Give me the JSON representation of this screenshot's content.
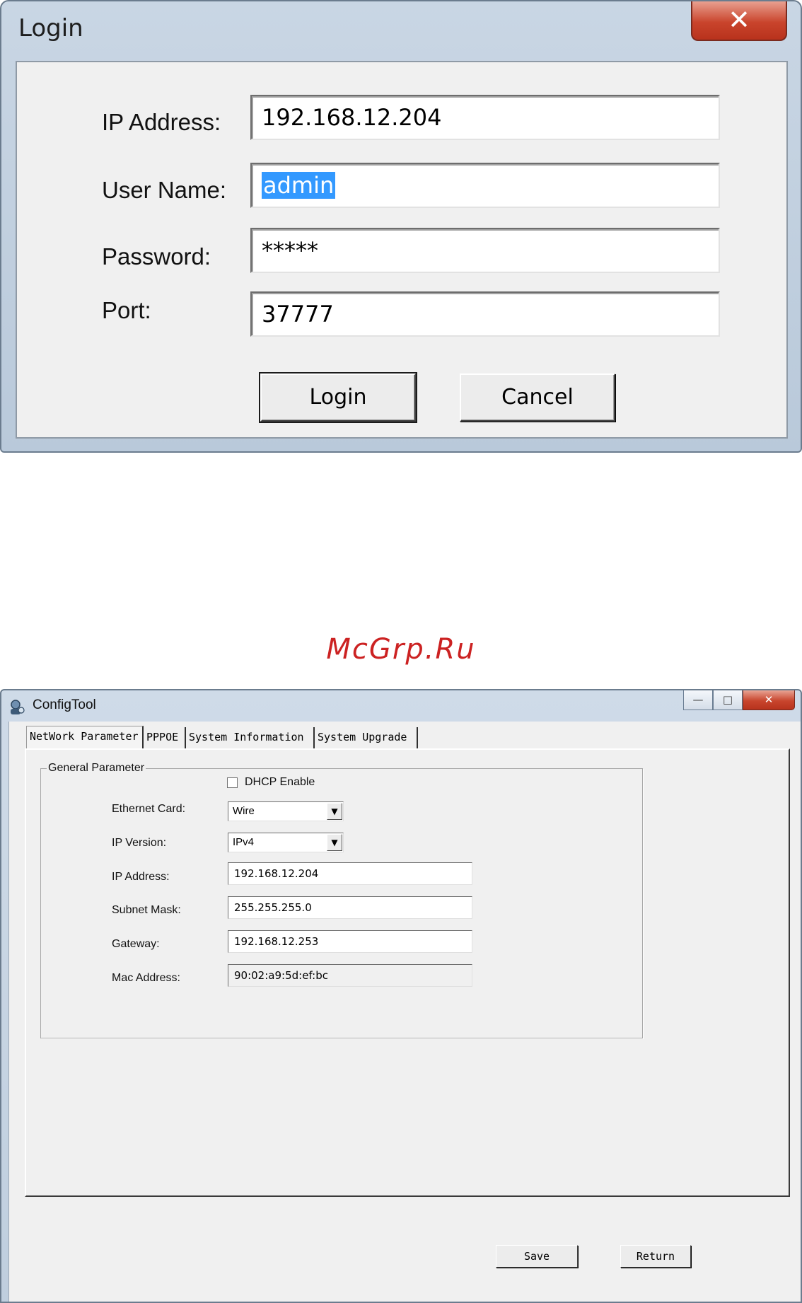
{
  "login_dialog": {
    "title": "Login",
    "close_glyph": "✕",
    "fields": {
      "ip_label": "IP Address:",
      "ip_value": "192.168.12.204",
      "user_label": "User Name:",
      "user_value": "admin",
      "password_label": "Password:",
      "password_value": "*****",
      "port_label": "Port:",
      "port_value": "37777"
    },
    "buttons": {
      "login": "Login",
      "cancel": "Cancel"
    }
  },
  "watermark": "McGrp.Ru",
  "config_tool": {
    "title": "ConfigTool",
    "window_controls": {
      "minimize": "—",
      "maximize": "□",
      "close": "✕"
    },
    "tabs": [
      "NetWork Parameter",
      "PPPOE",
      "System Information",
      "System Upgrade"
    ],
    "active_tab": "NetWork Parameter",
    "group_title": "General Parameter",
    "dhcp": {
      "label": "DHCP Enable",
      "checked": false
    },
    "ethernet_card": {
      "label": "Ethernet Card:",
      "value": "Wire"
    },
    "ip_version": {
      "label": "IP Version:",
      "value": "IPv4"
    },
    "ip_address": {
      "label": "IP Address:",
      "value": "192.168.12.204"
    },
    "subnet_mask": {
      "label": "Subnet Mask:",
      "value": "255.255.255.0"
    },
    "gateway": {
      "label": "Gateway:",
      "value": "192.168.12.253"
    },
    "mac_address": {
      "label": "Mac Address:",
      "value": "90:02:a9:5d:ef:bc"
    },
    "buttons": {
      "save": "Save",
      "return": "Return"
    }
  }
}
